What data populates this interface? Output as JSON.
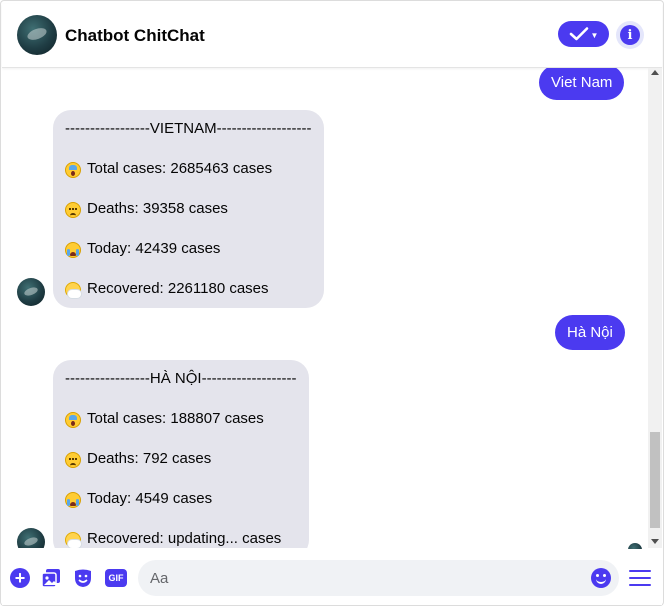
{
  "header": {
    "title": "Chatbot ChitChat",
    "avatar_icon": "profile-avatar",
    "check_icon": "checkmark-icon",
    "info_icon": "info-icon"
  },
  "messages": {
    "out1": "Viet Nam",
    "in1": {
      "title": "-----------------VIETNAM-------------------",
      "total": "Total cases: 2685463 cases",
      "deaths": "Deaths: 39358 cases",
      "today": "Today: 42439 cases",
      "recovered": "Recovered: 2261180 cases"
    },
    "out2": "Hà Nội",
    "in2": {
      "title": "-----------------HÀ NỘI-------------------",
      "total": "Total cases: 188807 cases",
      "deaths": "Deaths: 792 cases",
      "today": "Today: 4549 cases",
      "recovered": "Recovered: updating... cases"
    }
  },
  "composer": {
    "placeholder": "Aa",
    "gif_label": "GIF",
    "plus_label": "+"
  },
  "colors": {
    "accent": "#4b3af0",
    "incoming_bubble": "#e4e4ec"
  }
}
